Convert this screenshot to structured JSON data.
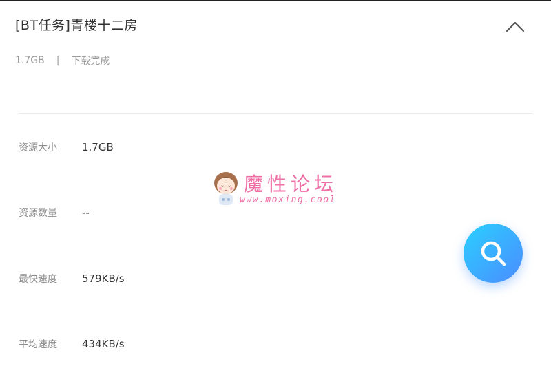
{
  "task": {
    "title": "[BT任务]青楼十二房",
    "size": "1.7GB",
    "separator": "|",
    "status": "下载完成"
  },
  "details": [
    {
      "label": "资源大小",
      "value": "1.7GB"
    },
    {
      "label": "资源数量",
      "value": "--"
    },
    {
      "label": "最快速度",
      "value": "579KB/s"
    },
    {
      "label": "平均速度",
      "value": "434KB/s"
    }
  ],
  "watermark": {
    "text": "魔性论坛",
    "url": "www.moxing.cool"
  },
  "icons": {
    "collapse": "chevron-up-icon",
    "search": "search-icon"
  },
  "colors": {
    "fab_gradient_start": "#2ad0ff",
    "fab_gradient_end": "#4b8cff",
    "watermark": "#ee6fa5"
  }
}
